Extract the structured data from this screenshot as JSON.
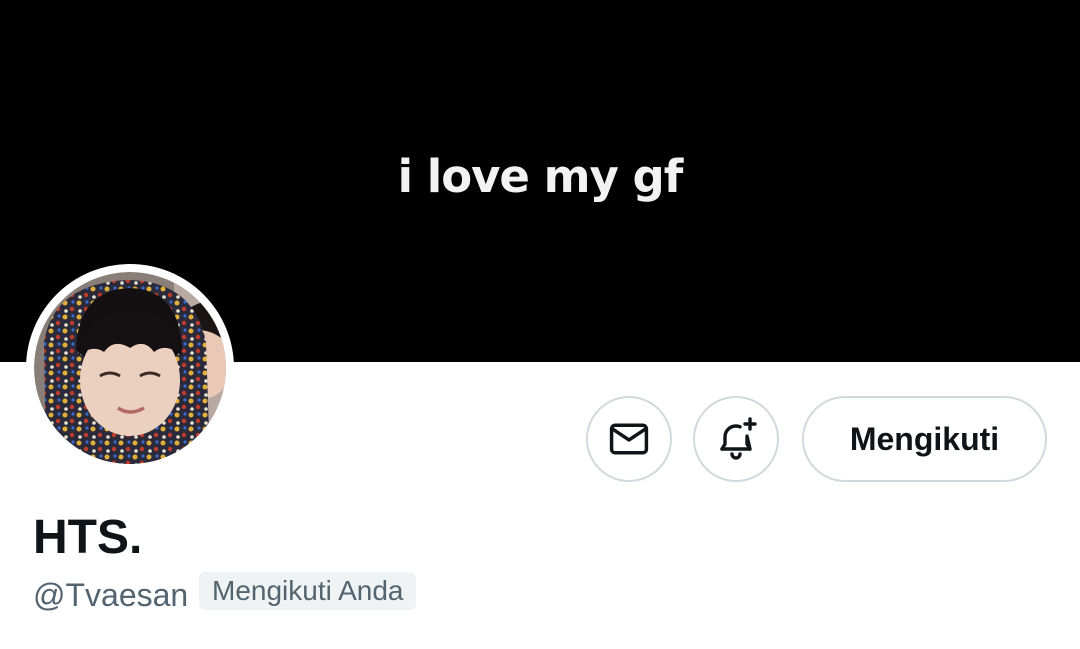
{
  "banner": {
    "text": "i love my gf",
    "background": "#000000"
  },
  "profile": {
    "display_name": "HTS.",
    "handle": "@Tvaesan",
    "follows_you_label": "Mengikuti Anda",
    "avatar_icon": "profile-photo"
  },
  "actions": {
    "message_icon": "envelope-icon",
    "notify_icon": "bell-plus-icon",
    "follow_label": "Mengikuti"
  },
  "colors": {
    "text_primary": "#0f1419",
    "text_secondary": "#536471",
    "border": "#cfd9de",
    "badge_bg": "#eff3f4"
  }
}
